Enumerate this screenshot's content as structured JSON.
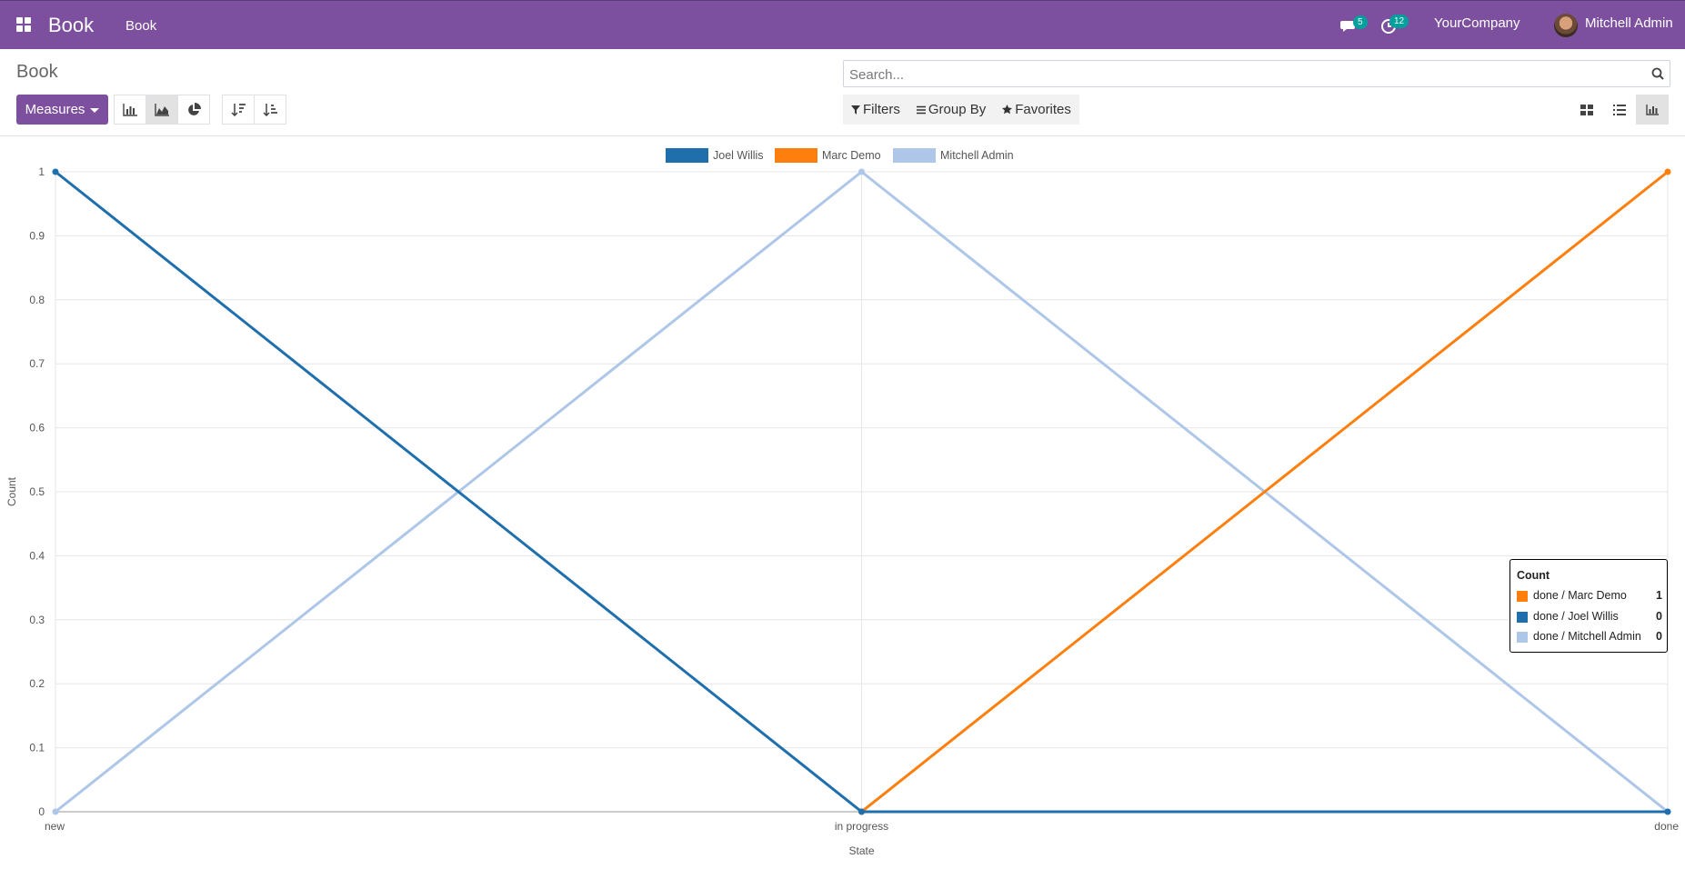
{
  "navbar": {
    "app_name": "Book",
    "menu_item": "Book",
    "messages_count": "5",
    "activities_count": "12",
    "company": "YourCompany",
    "user": "Mitchell Admin"
  },
  "control_panel": {
    "title": "Book",
    "measures_label": "Measures",
    "search_placeholder": "Search...",
    "filters_label": "Filters",
    "groupby_label": "Group By",
    "favorites_label": "Favorites"
  },
  "colors": {
    "brand": "#7c509f",
    "joel": "#1f6fad",
    "marc": "#ff7f0e",
    "mitchell": "#aec7e8",
    "badge": "#00a09d"
  },
  "chart_data": {
    "type": "line",
    "categories": [
      "new",
      "in progress",
      "done"
    ],
    "series": [
      {
        "name": "Joel Willis",
        "values": [
          1,
          0,
          0
        ],
        "color": "#1f6fad"
      },
      {
        "name": "Marc Demo",
        "values": [
          null,
          0,
          1
        ],
        "color": "#ff7f0e"
      },
      {
        "name": "Mitchell Admin",
        "values": [
          0,
          1,
          0
        ],
        "color": "#aec7e8"
      }
    ],
    "xlabel": "State",
    "ylabel": "Count",
    "ylim": [
      0,
      1
    ],
    "yticks": [
      "0",
      "0.1",
      "0.2",
      "0.3",
      "0.4",
      "0.5",
      "0.6",
      "0.7",
      "0.8",
      "0.9",
      "1"
    ],
    "grid": true,
    "legend": "top-center"
  },
  "tooltip": {
    "title": "Count",
    "rows": [
      {
        "label": "done / Marc Demo",
        "value": "1",
        "color": "#ff7f0e"
      },
      {
        "label": "done / Joel Willis",
        "value": "0",
        "color": "#1f6fad"
      },
      {
        "label": "done / Mitchell Admin",
        "value": "0",
        "color": "#aec7e8"
      }
    ]
  }
}
